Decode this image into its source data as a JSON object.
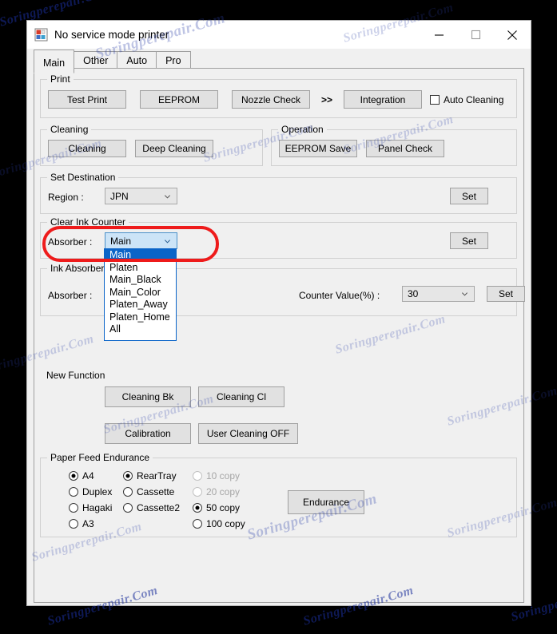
{
  "window": {
    "title": "No service mode printer",
    "icon": "printer-app-icon",
    "controls": {
      "minimize": "minimize-icon",
      "maximize": "maximize-icon",
      "close": "close-icon"
    }
  },
  "tabs": [
    {
      "label": "Main",
      "active": true
    },
    {
      "label": "Other",
      "active": false
    },
    {
      "label": "Auto",
      "active": false
    },
    {
      "label": "Pro",
      "active": false
    }
  ],
  "print": {
    "legend": "Print",
    "buttons": [
      "Test Print",
      "EEPROM",
      "Nozzle Check"
    ],
    "separator": ">>",
    "integration_label": "Integration",
    "auto_cleaning": {
      "label": "Auto Cleaning",
      "checked": false
    }
  },
  "cleaning": {
    "legend": "Cleaning",
    "buttons": [
      "Cleaning",
      "Deep Cleaning"
    ]
  },
  "operation": {
    "legend": "Operation",
    "buttons": [
      "EEPROM Save",
      "Panel Check"
    ]
  },
  "set_destination": {
    "legend": "Set Destination",
    "region_label": "Region :",
    "region_value": "JPN",
    "set_label": "Set"
  },
  "clear_ink_counter": {
    "legend": "Clear Ink Counter",
    "absorber_label": "Absorber :",
    "absorber_value": "Main",
    "set_label": "Set",
    "options": [
      "Main",
      "Platen",
      "Main_Black",
      "Main_Color",
      "Platen_Away",
      "Platen_Home",
      "All"
    ],
    "selected_option": "Main",
    "highlight_color": "#ee1b1b"
  },
  "ink_absorber_counter": {
    "legend": "Ink Absorber Counter",
    "absorber_label": "Absorber :",
    "counter_label": "Counter Value(%) :",
    "counter_value": "30",
    "set_label": "Set"
  },
  "new_function": {
    "legend": "New Function",
    "buttons": [
      "Cleaning Bk",
      "Cleaning Cl",
      "Calibration",
      "User Cleaning OFF"
    ]
  },
  "paper_feed_endurance": {
    "legend": "Paper Feed Endurance",
    "paper_sizes": [
      {
        "label": "A4",
        "selected": true,
        "disabled": false
      },
      {
        "label": "Duplex",
        "selected": false,
        "disabled": false
      },
      {
        "label": "Hagaki",
        "selected": false,
        "disabled": false
      },
      {
        "label": "A3",
        "selected": false,
        "disabled": false
      }
    ],
    "sources": [
      {
        "label": "RearTray",
        "selected": true,
        "disabled": false
      },
      {
        "label": "Cassette",
        "selected": false,
        "disabled": false
      },
      {
        "label": "Cassette2",
        "selected": false,
        "disabled": false
      }
    ],
    "copies": [
      {
        "label": "10 copy",
        "selected": false,
        "disabled": true
      },
      {
        "label": "20 copy",
        "selected": false,
        "disabled": true
      },
      {
        "label": "50 copy",
        "selected": true,
        "disabled": false
      },
      {
        "label": "100 copy",
        "selected": false,
        "disabled": false
      }
    ],
    "endurance_label": "Endurance"
  },
  "watermark": {
    "text": "Soringperepair.Com"
  }
}
